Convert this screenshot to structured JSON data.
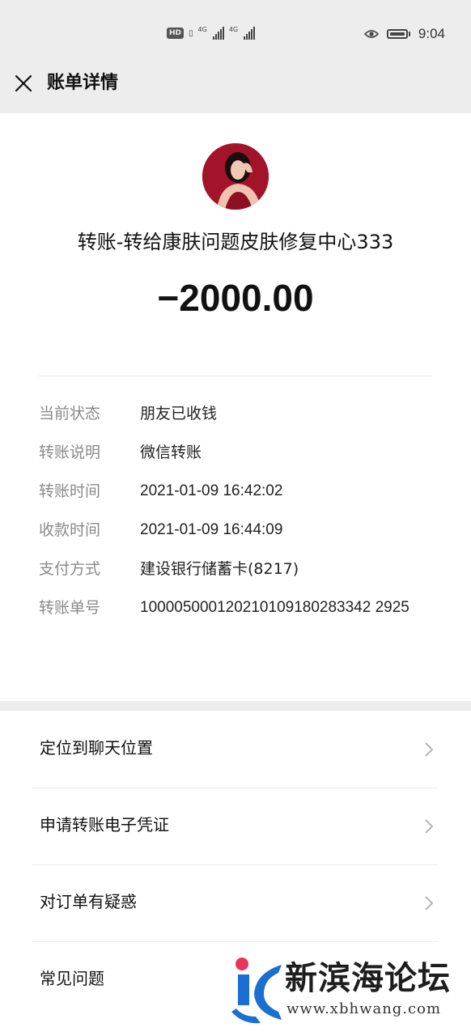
{
  "status_bar": {
    "hd_badge": "HD",
    "net1": "4G",
    "net2": "4G",
    "time": "9:04"
  },
  "nav": {
    "title": "账单详情"
  },
  "transaction": {
    "title": "转账-转给康肤问题皮肤修复中心333",
    "amount": "−2000.00"
  },
  "details": [
    {
      "label": "当前状态",
      "value": "朋友已收钱"
    },
    {
      "label": "转账说明",
      "value": "微信转账"
    },
    {
      "label": "转账时间",
      "value": "2021-01-09 16:42:02"
    },
    {
      "label": "收款时间",
      "value": "2021-01-09 16:44:09"
    },
    {
      "label": "支付方式",
      "value": "建设银行储蓄卡(8217)"
    },
    {
      "label": "转账单号",
      "value": "100005000120210109180283342 2925"
    }
  ],
  "actions": [
    {
      "label": "定位到聊天位置"
    },
    {
      "label": "申请转账电子凭证"
    },
    {
      "label": "对订单有疑惑"
    },
    {
      "label": "常见问题"
    }
  ],
  "watermark": {
    "text": "新滨海论坛",
    "url": "www.xbhwang.com"
  },
  "colors": {
    "background": "#ededed",
    "card": "#ffffff",
    "label_gray": "#8a8a8a",
    "watermark_red": "#e8365a",
    "watermark_blue": "#1a6fd1"
  }
}
